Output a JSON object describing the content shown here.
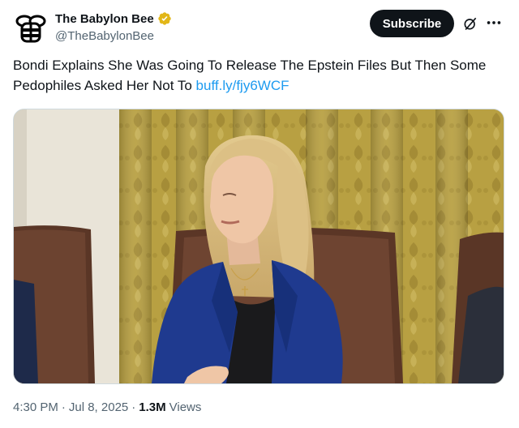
{
  "author": {
    "display_name": "The Babylon Bee",
    "handle": "@TheBabylonBee",
    "avatar_icon": "bee-logo-icon",
    "verified_icon": "verified-badge-icon",
    "verified_color": "#e2b719"
  },
  "actions": {
    "subscribe_label": "Subscribe",
    "grok_icon": "grok-icon",
    "more_icon": "more-icon"
  },
  "tweet": {
    "text": "Bondi Explains She Was Going To Release The Epstein Files But Then Some Pedophiles Asked Her Not To ",
    "link_text": "buff.ly/fjy6WCF"
  },
  "media": {
    "type": "photo"
  },
  "meta": {
    "time": "4:30 PM",
    "separator1": "·",
    "date": "Jul 8, 2025",
    "separator2": "·",
    "views_count": "1.3M",
    "views_label": "Views"
  },
  "colors": {
    "text": "#0f1419",
    "secondary": "#536471",
    "link": "#1d9bf0",
    "button_bg": "#0f1419"
  }
}
